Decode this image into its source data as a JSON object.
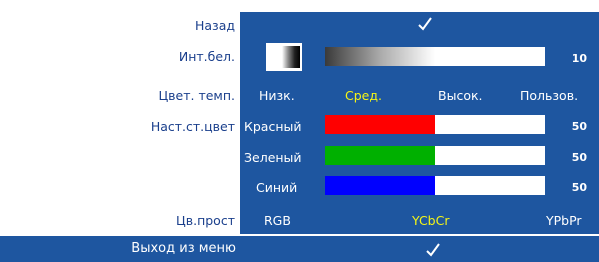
{
  "menu": {
    "back": {
      "label": "Назад"
    },
    "white_intensity": {
      "label": "Инт.бел.",
      "value": "10",
      "level": 0.1
    },
    "color_temp": {
      "label": "Цвет. темп.",
      "options": [
        "Низк.",
        "Сред.",
        "Высок.",
        "Пользов."
      ],
      "selected": "Сред."
    },
    "user_color": {
      "label": "Наст.ст.цвет",
      "channels": [
        {
          "label": "Красный",
          "value": "50",
          "color": "#ff0000"
        },
        {
          "label": "Зеленый",
          "value": "50",
          "color": "#00b000"
        },
        {
          "label": "Синий",
          "value": "50",
          "color": "#0000ff"
        }
      ]
    },
    "color_space": {
      "label": "Цв.прост",
      "options": [
        "RGB",
        "YCbCr",
        "YPbPr"
      ],
      "selected": "YCbCr"
    },
    "exit": {
      "label": "Выход из меню"
    }
  },
  "colors": {
    "panel_blue": "#1e56a0",
    "label_blue": "#1a3f8c",
    "highlight_yellow": "#f5f516"
  },
  "icons": {
    "confirm": "checkmark-icon"
  }
}
